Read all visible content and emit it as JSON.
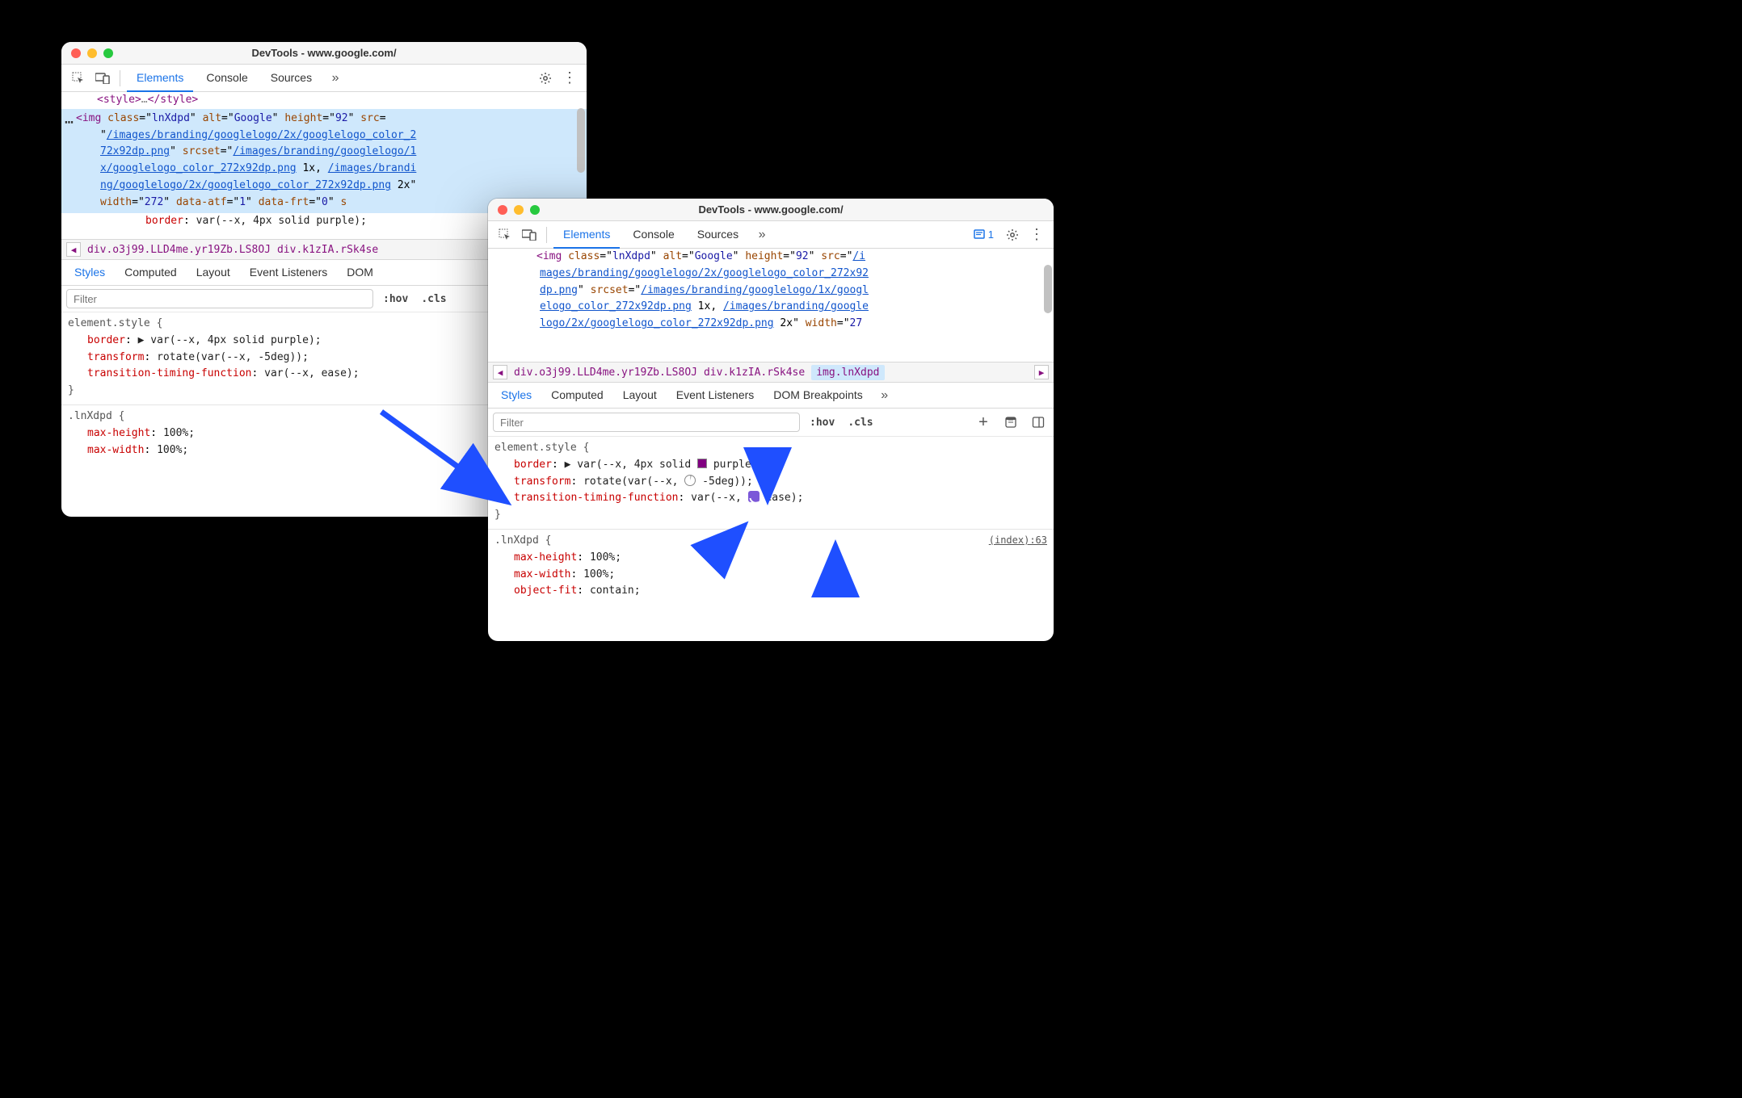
{
  "windowA": {
    "title": "DevTools - www.google.com/",
    "tabs": [
      "Elements",
      "Console",
      "Sources"
    ],
    "dom_lines": {
      "style_close": "<style>…</style>",
      "selected": "<img class=\"lnXdpd\" alt=\"Google\" height=\"92\" src=\"/images/branding/googlelogo/2x/googlelogo_color_272x92dp.png\" srcset=\"/images/branding/googlelogo/1x/googlelogo_color_272x92dp.png 1x, /images/branding/googlelogo/2x/googlelogo_color_272x92dp.png 2x\" width=\"272\" data-atf=\"1\" data-frt=\"0\" s",
      "extra": "border: var(--x, 4px solid purple);"
    },
    "crumbs": [
      "div.o3j99.LLD4me.yr19Zb.LS8OJ",
      "div.k1zIA.rSk4se"
    ],
    "subtabs": [
      "Styles",
      "Computed",
      "Layout",
      "Event Listeners",
      "DOM "
    ],
    "filter_placeholder": "Filter",
    "filter_toks": [
      ":hov",
      ".cls"
    ],
    "style_rules": {
      "element_style_label": "element.style {",
      "border": {
        "prop": "border",
        "val": "▶︎ var(--x, 4px solid purple);"
      },
      "transform": {
        "prop": "transform",
        "val": "rotate(var(--x, -5deg));"
      },
      "ttf": {
        "prop": "transition-timing-function",
        "val": "var(--x, ease);"
      },
      "close": "}",
      "clsname": ".lnXdpd {",
      "maxh": {
        "prop": "max-height",
        "val": "100%;"
      },
      "maxw": {
        "prop": "max-width",
        "val": "100%;"
      }
    }
  },
  "windowB": {
    "title": "DevTools - www.google.com/",
    "tabs": [
      "Elements",
      "Console",
      "Sources"
    ],
    "issues_count": "1",
    "crumbs": [
      "div.o3j99.LLD4me.yr19Zb.LS8OJ",
      "div.k1zIA.rSk4se",
      "img.lnXdpd"
    ],
    "subtabs": [
      "Styles",
      "Computed",
      "Layout",
      "Event Listeners",
      "DOM Breakpoints"
    ],
    "filter_placeholder": "Filter",
    "filter_toks": [
      ":hov",
      ".cls"
    ],
    "src_link": "(index):63",
    "style_rules": {
      "element_style_label": "element.style {",
      "border": {
        "prop": "border",
        "prefix": "▶︎ var(--x, 4px solid ",
        "color": "purple",
        "suffix": ");"
      },
      "transform": {
        "prop": "transform",
        "prefix": "rotate(var(--x, ",
        "deg": "-5deg",
        "suffix": "));"
      },
      "ttf": {
        "prop": "transition-timing-function",
        "prefix": "var(--x, ",
        "ease": "ease",
        "suffix": ");"
      },
      "close": "}",
      "clsname": ".lnXdpd {",
      "maxh": {
        "prop": "max-height",
        "val": "100%;"
      },
      "maxw": {
        "prop": "max-width",
        "val": "100%;"
      },
      "objf": {
        "prop": "object-fit",
        "val": "contain;"
      }
    }
  },
  "colors": {
    "purple_swatch": "#800080"
  }
}
